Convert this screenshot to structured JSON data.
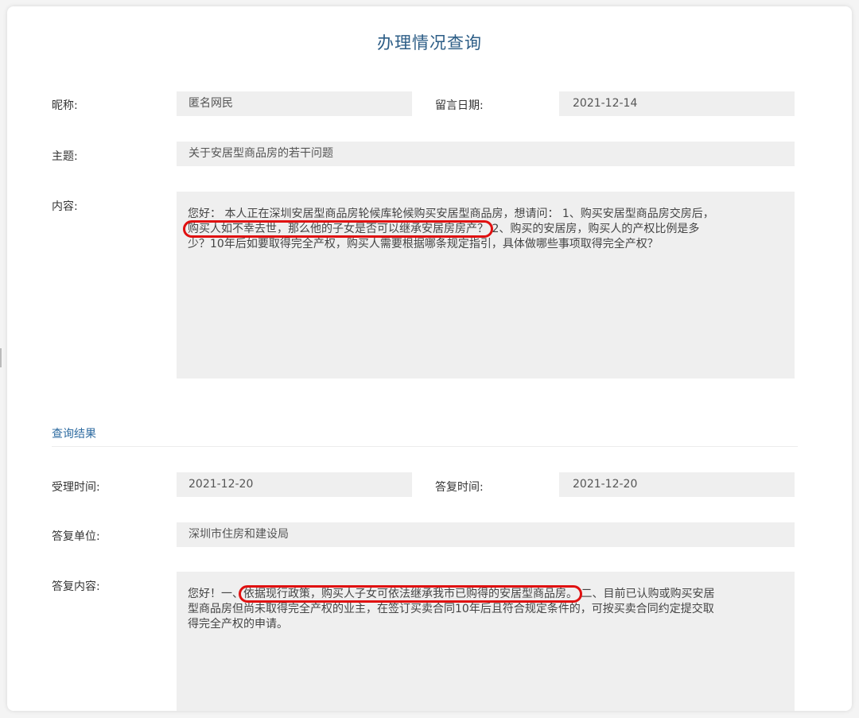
{
  "page": {
    "title": "办理情况查询"
  },
  "inquiry": {
    "nickname_label": "昵称:",
    "nickname_value": "匿名网民",
    "date_label": "留言日期:",
    "date_value": "2021-12-14",
    "subject_label": "主题:",
    "subject_value": "关于安居型商品房的若干问题",
    "content_label": "内容:",
    "content_lines": {
      "l1": "您好：  本人正在深圳安居型商品房轮候库轮候购买安居型商品房，想请问：  1、购买安居型商品房交房后，",
      "l2_highlight": "购买人如不幸去世，那么他的子女是否可以继承安居房房产？",
      "l2_rest": "2、购买的安居房，购买人的产权比例是多",
      "l3": "少？10年后如要取得完全产权，购买人需要根据哪条规定指引，具体做哪些事项取得完全产权？"
    }
  },
  "result": {
    "section_title": "查询结果",
    "accept_time_label": "受理时间:",
    "accept_time_value": "2021-12-20",
    "reply_time_label": "答复时间:",
    "reply_time_value": "2021-12-20",
    "reply_unit_label": "答复单位:",
    "reply_unit_value": "深圳市住房和建设局",
    "reply_content_label": "答复内容:",
    "reply_lines": {
      "l1_start": "您好！一、",
      "l1_highlight": "依据现行政策，购买人子女可依法继承我市已购得的安居型商品房。",
      "l1_rest": "二、目前已认购或购买安居",
      "l2": "型商品房但尚未取得完全产权的业主，在签订买卖合同10年后且符合规定条件的，可按买卖合同约定提交取",
      "l3": "得完全产权的申请。"
    }
  },
  "colors": {
    "accent": "#2c5d86",
    "highlight": "#e01010",
    "field_bg": "#efefef"
  }
}
